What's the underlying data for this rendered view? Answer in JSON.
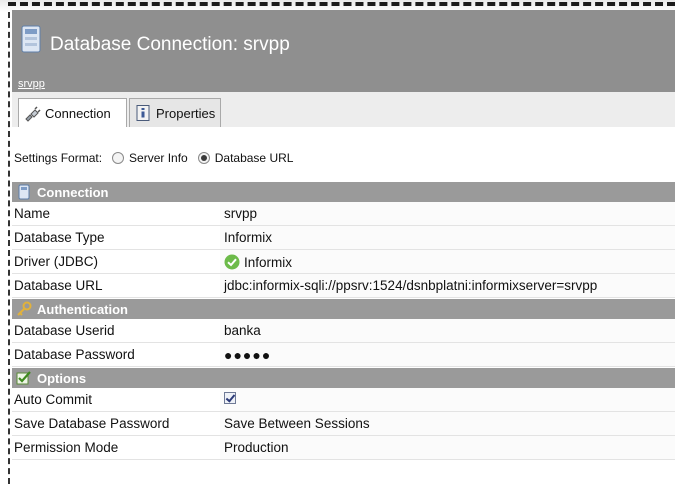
{
  "header": {
    "title": "Database Connection: srvpp",
    "breadcrumb": "srvpp",
    "icon": "database-icon"
  },
  "tabs": [
    {
      "label": "Connection",
      "icon": "plug-icon",
      "active": true
    },
    {
      "label": "Properties",
      "icon": "properties-icon",
      "active": false
    }
  ],
  "settings": {
    "label": "Settings Format:",
    "options": [
      {
        "label": "Server Info",
        "selected": false
      },
      {
        "label": "Database URL",
        "selected": true
      }
    ]
  },
  "sections": {
    "connection": {
      "title": "Connection",
      "icon": "database-icon",
      "rows": {
        "name": {
          "label": "Name",
          "value": "srvpp"
        },
        "db_type": {
          "label": "Database Type",
          "value": "Informix"
        },
        "driver": {
          "label": "Driver (JDBC)",
          "value": "Informix",
          "icon": "check-circle-icon"
        },
        "url": {
          "label": "Database URL",
          "value": "jdbc:informix-sqli://ppsrv:1524/dsnbplatni:informixserver=srvpp"
        }
      }
    },
    "authentication": {
      "title": "Authentication",
      "icon": "key-icon",
      "rows": {
        "userid": {
          "label": "Database Userid",
          "value": "banka"
        },
        "password": {
          "label": "Database Password",
          "value": "●●●●●"
        }
      }
    },
    "options": {
      "title": "Options",
      "icon": "checkmark-icon",
      "rows": {
        "auto_commit": {
          "label": "Auto Commit",
          "checked": true
        },
        "save_password": {
          "label": "Save Database Password",
          "value": "Save Between Sessions"
        },
        "permission": {
          "label": "Permission Mode",
          "value": "Production"
        }
      }
    }
  },
  "colors": {
    "header_bg": "#8f8f8f",
    "section_bg": "#9a9a9a",
    "accent_green": "#6dbb4a"
  }
}
